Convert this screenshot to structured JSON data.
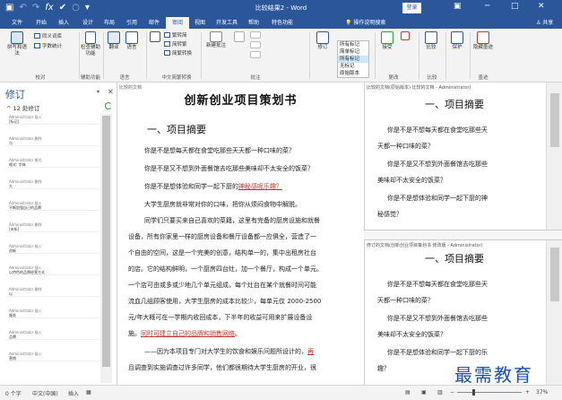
{
  "titlebar": {
    "doc_title": "比较结果2 - Word",
    "login": "登录",
    "min": "─",
    "max": "□",
    "close": "✕",
    "ribbon_display": "▣"
  },
  "tabs": [
    {
      "label": "文件"
    },
    {
      "label": "开始"
    },
    {
      "label": "插入"
    },
    {
      "label": "设计"
    },
    {
      "label": "布局"
    },
    {
      "label": "引用"
    },
    {
      "label": "邮件"
    },
    {
      "label": "审阅"
    },
    {
      "label": "视图"
    },
    {
      "label": "开发工具"
    },
    {
      "label": "帮助"
    },
    {
      "label": "特色功能"
    }
  ],
  "tell_me": "操作说明搜索",
  "share": "共享",
  "ribbon": {
    "spelling": "拼写和语法",
    "thesaurus": "同义词库",
    "word_count": "字数统计",
    "proofing_group": "校对",
    "check_accessibility": "检查辅助功能",
    "accessibility_group": "辅助功能",
    "translate": "翻译",
    "language": "语言",
    "language_group": "语言",
    "trad_to_simp": "繁转简",
    "simp_to_trad": "简转繁",
    "convert": "简繁转换",
    "chinese_group": "中文简繁转换",
    "new_comment": "新建批注",
    "comments_group": "批注",
    "track_changes": "修订",
    "markup_options": [
      "所有标记",
      "简单标记",
      "所有标记",
      "无标记",
      "原始版本"
    ],
    "accept": "接受",
    "changes_group": "更改",
    "compare": "比较",
    "compare_group": "比较",
    "protect": "保护",
    "ink_hide": "隐藏墨迹",
    "ink_group": "墨迹"
  },
  "revisions": {
    "title": "修订",
    "count": "12 处修订",
    "items": [
      {
        "author": "Administrator 插入",
        "text": "[标记]"
      },
      {
        "author": "Administrator 删除",
        "text": "与"
      },
      {
        "author": "Administrator 格式",
        "text": "格式: 字体"
      },
      {
        "author": "Administrator 删除",
        "text": "大"
      },
      {
        "author": "Administrator 插入",
        "text": "不断加强自己的品牌"
      },
      {
        "author": "Administrator 删除",
        "text": "[未知]"
      },
      {
        "author": "Administrator 插入",
        "text": "创新"
      },
      {
        "author": "Administrator 插入",
        "text": "以特色的品牌经营方式"
      },
      {
        "author": "Administrator 删除",
        "text": "以"
      },
      {
        "author": "Administrator 插入",
        "text": "服务"
      },
      {
        "author": "Administrator 插入",
        "text": "品牌"
      },
      {
        "author": "Administrator 插入",
        "text": "营销"
      }
    ]
  },
  "document": {
    "tab_caption": "比较的文档",
    "heading": "创新创业项目策划书",
    "section": "一、项目摘要",
    "lines": [
      "你是不是想每天都在食堂吃那些天天都一种口味的菜？",
      "你是不是又不想到外面餐馆去吃那些美味却不太安全的饭菜？",
      "你是不是想体验和同学一起下厨的",
      "大学生厨房就非常对你的口味，把你从烦闷食物中解脱。",
      "同学们只要买来自己喜欢的菜籍，这里有完备的厨房设施和就餐",
      "设备，所有你家里一样的厨房设备和餐厅设备都一应俱全，营造了一",
      "个自由的空间，这是一个完美的创意，结构单一的，集中出租房社台",
      "的店。它的结构鲜明，一个厨房四台灶，加一个餐厅，构成一个单元。",
      "一个店可由或多或少地几个单元组成，每个灶台在某个就餐时间可能",
      "流血几组顾客使用，大学生厨房的成本比较少，每单元仅 2000-2500",
      "元/年大概可在一学期内收回成本，下半年的收益可用来扩展设备设",
      "施。",
      "——因为本项目专门对大学生的饮食和娱乐问题所设计的，",
      "且调查到实施调查过许多同学，他们都很期待大学生厨房的开业，很"
    ],
    "inserted_1": "神秘感呢乐趣？",
    "inserted_2": "同时可建立自己的品牌和销售网络",
    "inserted_3": "再",
    "period": "。"
  },
  "original": {
    "caption": "比较的文档(原始版本)·比较的文档 - Administrator)",
    "heading": "一、项目摘要",
    "lines": [
      "你是不是不想每天都在食堂吃那些天",
      "天都一种口味的菜？",
      "你是不是又不想到外面餐馆去吃那些",
      "美味却不太安全的饭菜？",
      "你是不是想体验和同学一起下厨的神",
      "秘感觉？"
    ]
  },
  "revised": {
    "caption": "修订的文档(创新创业项目策划书 修改版 - Administrator)",
    "heading": "一、项目摘要",
    "lines": [
      "你是不是不想每天都在食堂吃那些天",
      "天都一种口味的菜？",
      "你是不是又不想到外面餐馆去吃那些",
      "美味却不太安全的饭菜？",
      "你是不是想体验和同学一起下厨的乐",
      "趣？"
    ]
  },
  "status": {
    "words": "0 个字",
    "language": "中文(中国)",
    "mode": "插入",
    "zoom": "37%"
  },
  "watermark": "最需教育"
}
